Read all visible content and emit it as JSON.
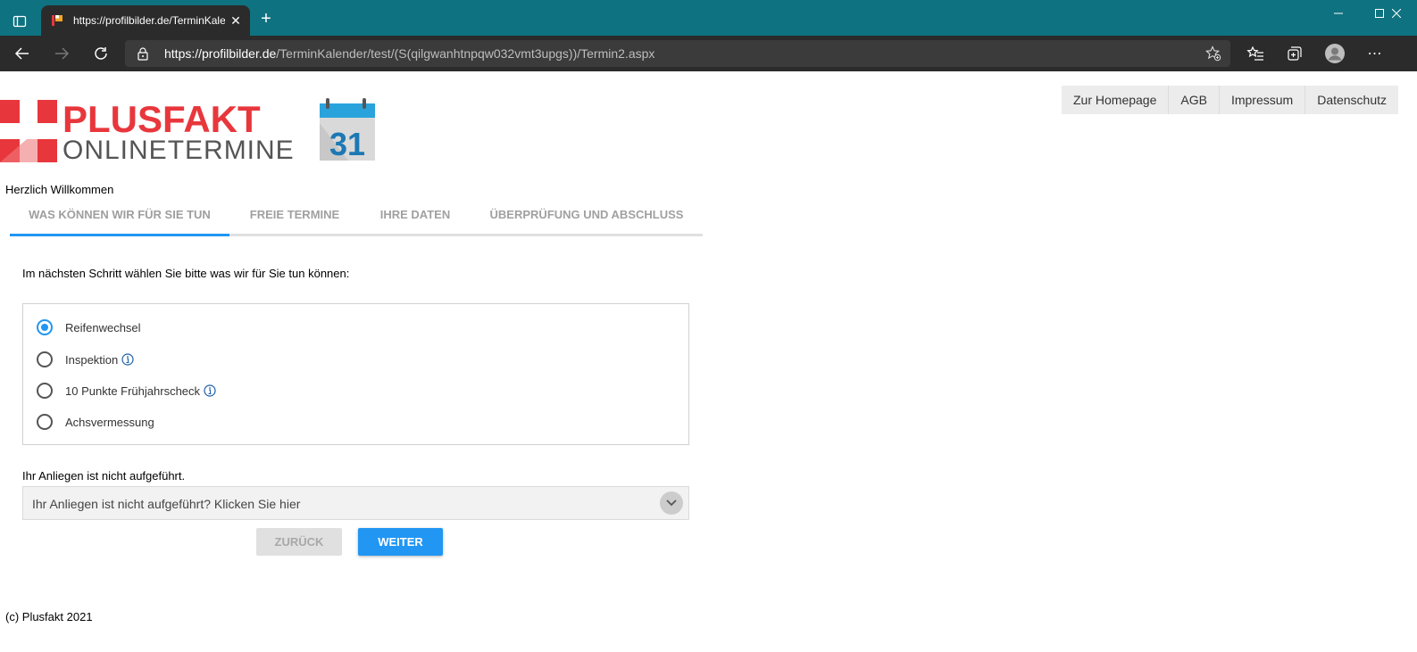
{
  "browser": {
    "tab_title": "https://profilbilder.de/TerminKalender/test/(S(qilgwanhtnpqw032vmt3upgs))/Termin2.aspx",
    "url_domain": "https://profilbilder.de",
    "url_path": "/TerminKalender/test/(S(qilgwanhtnpqw032vmt3upgs))/Termin2.aspx",
    "accent": "#0f7280"
  },
  "logo": {
    "brand": "PLUSFAKT",
    "sub": "ONLINETERMINE",
    "calendar_day": "31",
    "brand_color": "#e8373c"
  },
  "topnav": {
    "items": [
      "Zur Homepage",
      "AGB",
      "Impressum",
      "Datenschutz"
    ]
  },
  "welcome": "Herzlich Willkommen",
  "steps": [
    "WAS KÖNNEN WIR FÜR SIE TUN",
    "FREIE TERMINE",
    "IHRE DATEN",
    "ÜBERPRÜFUNG UND ABSCHLUSS"
  ],
  "prompt": "Im nächsten Schritt wählen Sie bitte was wir für Sie tun können:",
  "options": [
    {
      "label": "Reifenwechsel",
      "checked": true
    },
    {
      "label": "Inspektion",
      "checked": false
    },
    {
      "label": "10 Punkte Frühjahrscheck",
      "checked": false
    },
    {
      "label": "Achsvermessung",
      "checked": false
    }
  ],
  "not_listed": {
    "label": "Ihr Anliegen ist nicht aufgeführt.",
    "dropdown": "Ihr Anliegen ist nicht aufgeführt? Klicken Sie hier"
  },
  "buttons": {
    "back": "ZURÜCK",
    "next": "WEITER",
    "primary_color": "#2196f3"
  },
  "footer": "(c) Plusfakt 2021"
}
